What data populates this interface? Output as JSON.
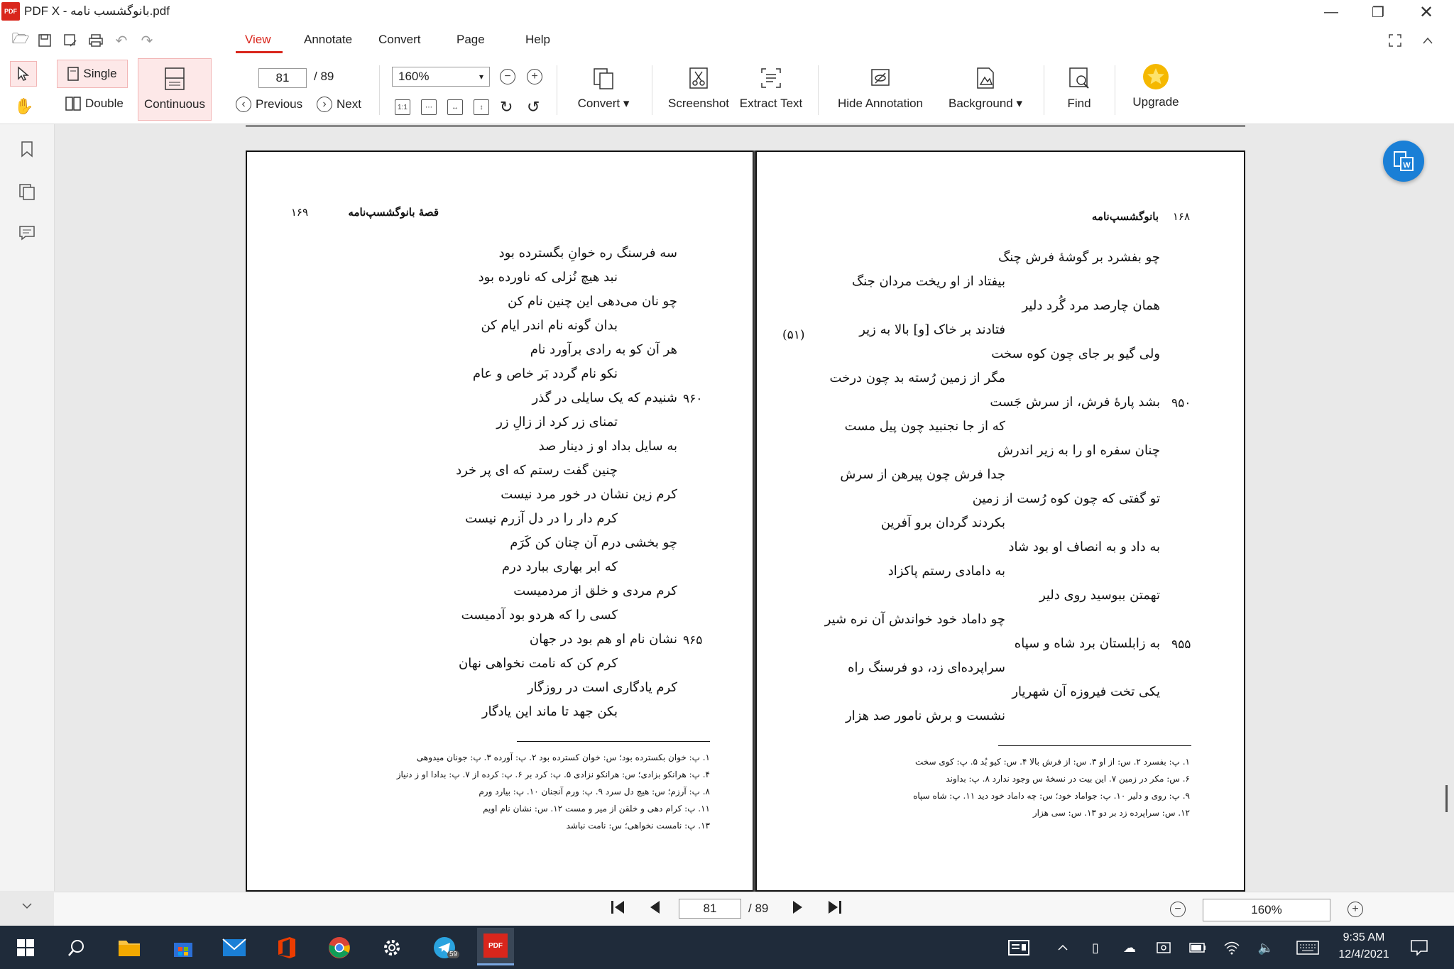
{
  "window": {
    "title": "PDF X - بانوگشسب نامه.pdf",
    "logo_text": "PDF"
  },
  "menu": {
    "items": [
      "View",
      "Annotate",
      "Convert",
      "Page",
      "Help"
    ]
  },
  "toolbar": {
    "single_label": "Single",
    "double_label": "Double",
    "continuous_label": "Continuous",
    "page_value": "81",
    "page_total": "/ 89",
    "previous_label": "Previous",
    "next_label": "Next",
    "zoom_value": "160%",
    "convert_label": "Convert",
    "screenshot_label": "Screenshot",
    "extract_text_label": "Extract Text",
    "hide_annotation_label": "Hide Annotation",
    "background_label": "Background",
    "find_label": "Find",
    "upgrade_label": "Upgrade"
  },
  "left_page": {
    "header": "قصهٔ بانوگشسپ‌نامه",
    "page_number": "۱۶۹",
    "lines": [
      "سه فرسنگ ره خوانِ بگسترده بود",
      "نبد هیچ نُزلی که ناورده بود",
      "چو نان می‌دهی این چنین نام کن",
      "بدان گونه نام اندر ایام کن",
      "هر آن کو به رادی برآورد نام",
      "نکو نام گردد بَر خاص و عام",
      "شنیدم که یک سایلی در گذر",
      "تمنای زر کرد از زالِ زر",
      "به سایل بداد او ز دینار صد",
      "چنین گفت رستم که ای پر خرد",
      "کرم زین نشان در خور مرد نیست",
      "کرم دار را در دل آزرم نیست",
      "چو بخشی درم آن چنان کن کَرَم",
      "که ابر بهاری ببارد درم",
      "کرم مردی و خلق از مردمیست",
      "کسی را که هردو بود آدمیست",
      "نشان نام او هم بود در جهان",
      "کرم کن که نامت نخواهی نهان",
      "کرم یادگاری است در روزگار",
      "بکن جهد تا ماند این یادگار"
    ],
    "verse_numbers": [
      "۹۶۰",
      "۹۶۵"
    ],
    "footnotes": [
      "۱. پ: خوان بکسترده بود؛ س: خوان کسترده بود    ۲. پ: آورده    ۳. پ: جونان میدوهی",
      "۴. پ: هرانکو بزادی؛ س: هرانکو نزادی    ۵. پ: کرد بر    ۶. پ: کرده از    ۷. پ: بدادا او ز دنیاز",
      "۸. پ: آرزم؛ س: هیچ دل سرد    ۹. پ: ورم آنجنان    ۱۰. پ: بیارد ورم",
      "۱۱. پ: کرام دهی و خلقن از میر و مست    ۱۲. س: نشان نام اویم",
      "۱۳. پ: نامست نخواهی؛ س: نامت نباشد"
    ]
  },
  "right_page": {
    "header": "بانوگشسپ‌نامه",
    "page_number": "۱۶۸",
    "lines": [
      "چو بفشرد بر گوشهٔ فرش چنگ",
      "بیفتاد از او ریخت مردان جنگ",
      "همان چارصد مرد گُرد دلیر",
      "فتادند بر خاک [و] بالا به زیر",
      "ولی گیو بر جای چون کوه سخت",
      "مگر از زمین رُسته بد چون درخت",
      "بشد پارهٔ فرش، از سرش جَست",
      "که از جا نجنبید چون پیل مست",
      "چنان سفره او را به زیر اندرش",
      "جدا فرش چون پیرهن از سرش",
      "تو گفتی که چون کوه رُست از زمین",
      "بکردند گردان برو آفرین",
      "به داد و به انصاف او بود شاد",
      "به دامادی رستم پاکزاد",
      "تهمتن ببوسید روی دلیر",
      "چو داماد خود خواندش آن نره شیر",
      "به زابلستان برد شاه و سپاه",
      "سراپرده‌ای زد، دو فرسنگ راه",
      "یکی تخت فیروزه آن شهریار",
      "نشست و برش نامور صد هزار"
    ],
    "verse_numbers": [
      "۹۵۰",
      "۹۵۵"
    ],
    "margin_note": "(۵۱)",
    "footnotes": [
      "۱. پ: بفسرد    ۲. س: از او    ۳. س: از فرش بالا    ۴. س: کیو بُد    ۵. پ: کوی سخت",
      "۶. س: مکر در زمین    ۷. این بیت در نسخهٔ س وجود ندارد    ۸. پ: بداوند",
      "۹. پ: روی و دلیر    ۱۰. پ: جواماد خود؛ س: چه داماد خود دید    ۱۱. پ: شاه سپاه",
      "۱۲. س: سراپرده زد بر دو    ۱۳. س: سی هزار"
    ]
  },
  "bottom_nav": {
    "page_value": "81",
    "page_total": "/ 89",
    "zoom_value": "160%"
  },
  "taskbar": {
    "time": "9:35 AM",
    "date": "12/4/2021",
    "telegram_badge": "59",
    "pdfx_caption": "PDF"
  },
  "colors": {
    "accent": "#d9261c",
    "taskbar": "#1f2b3a",
    "active_button_bg": "#fde8e8"
  }
}
